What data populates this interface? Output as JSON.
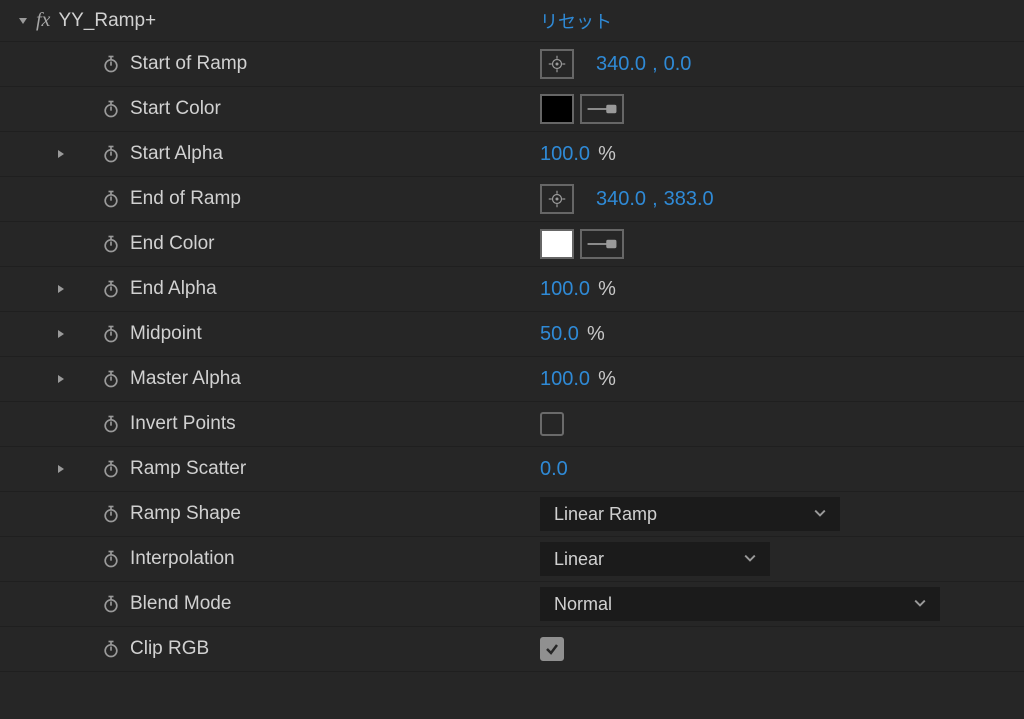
{
  "effect": {
    "name": "YY_Ramp+",
    "reset": "リセット"
  },
  "props": {
    "start_of_ramp": {
      "label": "Start of Ramp",
      "x": "340.0",
      "y": "0.0"
    },
    "start_color": {
      "label": "Start Color"
    },
    "start_alpha": {
      "label": "Start Alpha",
      "value": "100.0",
      "unit": "%"
    },
    "end_of_ramp": {
      "label": "End of Ramp",
      "x": "340.0",
      "y": "383.0"
    },
    "end_color": {
      "label": "End Color"
    },
    "end_alpha": {
      "label": "End Alpha",
      "value": "100.0",
      "unit": "%"
    },
    "midpoint": {
      "label": "Midpoint",
      "value": "50.0",
      "unit": "%"
    },
    "master_alpha": {
      "label": "Master Alpha",
      "value": "100.0",
      "unit": "%"
    },
    "invert_points": {
      "label": "Invert Points"
    },
    "ramp_scatter": {
      "label": "Ramp Scatter",
      "value": "0.0"
    },
    "ramp_shape": {
      "label": "Ramp Shape",
      "value": "Linear Ramp"
    },
    "interpolation": {
      "label": "Interpolation",
      "value": "Linear"
    },
    "blend_mode": {
      "label": "Blend Mode",
      "value": "Normal"
    },
    "clip_rgb": {
      "label": "Clip RGB"
    }
  },
  "sep": ","
}
